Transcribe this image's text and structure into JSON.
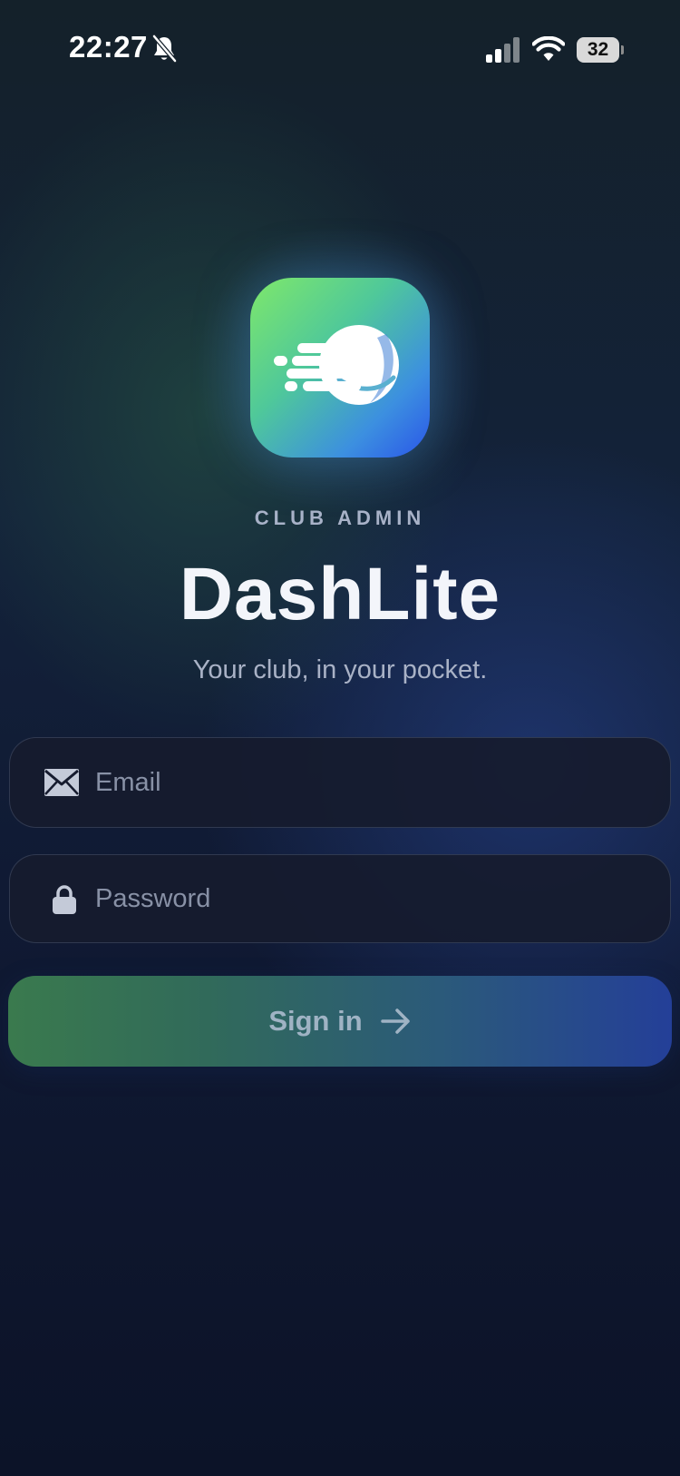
{
  "status_bar": {
    "time": "22:27",
    "battery_level": "32",
    "icons": [
      "bell-off-icon",
      "signal-icon",
      "wifi-icon",
      "battery-icon"
    ]
  },
  "logo": {
    "icon": "app-logo-icon",
    "gradient_colors": [
      "#7fe86a",
      "#3c8fe0",
      "#2a56e8"
    ]
  },
  "header": {
    "eyebrow": "CLUB ADMIN",
    "title": "DashLite",
    "tagline": "Your club, in your pocket."
  },
  "form": {
    "email": {
      "icon": "envelope-icon",
      "value": "",
      "placeholder": "Email"
    },
    "password": {
      "icon": "lock-icon",
      "value": "",
      "placeholder": "Password"
    },
    "submit": {
      "label": "Sign in",
      "icon": "arrow-right-icon",
      "gradient_colors": [
        "#3a7a4e",
        "#243f98"
      ]
    }
  },
  "colors": {
    "background_top": "#14212a",
    "background_bottom": "#0c1328",
    "field_background": "#161b2e",
    "text_primary": "#f3f5fa",
    "text_secondary": "#a9b2c6"
  }
}
